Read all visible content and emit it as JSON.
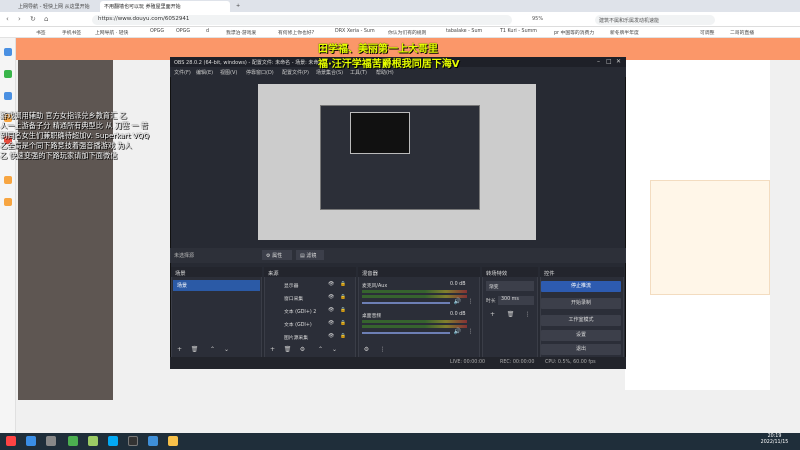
{
  "browser": {
    "tabs": [
      "上网导航 - 轻快上网 从这里开始",
      "不用翻墙也可以玩 养殖屋里面开始",
      "+"
    ],
    "url": "https://www.douyu.com/6052941",
    "search_hint": "建筑不属和乐属发动机速能",
    "zoom": "95%",
    "bookmarks": [
      "书签",
      "手机书签",
      "上网导航 · 轻快",
      "OPGG",
      "OPGG",
      "d",
      "我漂泊·游戏爱",
      "有何修上你也好?",
      "DRX Xeria - Sum",
      "你认为们有的规则",
      "tabalake - Sum",
      "T1 Kuri - Summ",
      "pr 中国等的消费力",
      "新冬牌半年度",
      "可调整",
      "二哥的直播"
    ]
  },
  "overlay": {
    "yellow_line1": "田学福、美丽第一上大哥里",
    "yellow_line2": "福·汪汗学福苦爵根我同居下海V",
    "white_lines": [
      "游戏调用辅助 官方女指派兑乡教育汇 乙",
      "人一上游备子分 精通所有典型比 从 刀塞 一 普",
      "到同名女生们兼职确待超加V: Superkart VQQ",
      "乙全局是个同下路竞技着强音播游戏 为人",
      "乙 快速变强的下路玩家请加下面微信"
    ]
  },
  "obs": {
    "title": "OBS 28.0.2 (64-bit, windows) - 配置文件: 未命名 - 场景: 未命名",
    "menu": [
      "文件(F)",
      "编辑(E)",
      "视图(V)",
      "停靠窗口(D)",
      "配置文件(P)",
      "场景集合(S)",
      "工具(T)",
      "帮助(H)"
    ],
    "toolbar": {
      "no_source": "未选择源",
      "properties": "属性",
      "filters": "滤镜"
    },
    "docks": {
      "scenes": {
        "title": "场景",
        "items": [
          "场景"
        ]
      },
      "sources": {
        "title": "来源",
        "items": [
          "显示器",
          "窗口采集",
          "文本 (GDI+) 2",
          "文本 (GDI+)",
          "图片源采集"
        ]
      },
      "mixer": {
        "title": "混音器",
        "tracks": [
          {
            "name": "麦克风/Aux",
            "db": "0.0 dB"
          },
          {
            "name": "桌面音频",
            "db": "0.0 dB"
          }
        ]
      },
      "transitions": {
        "title": "转场特效",
        "type": "渐变",
        "duration_label": "时长",
        "duration": "300 ms"
      },
      "controls": {
        "title": "控件",
        "buttons": [
          "停止推流",
          "开始录制",
          "工作室模式",
          "设置",
          "退出"
        ]
      }
    },
    "status": {
      "live": "LIVE: 00:00:00",
      "rec": "REC: 00:00:00",
      "cpu": "CPU: 0.5%, 60.00 fps"
    }
  },
  "taskbar": {
    "time": "20:19",
    "date": "2022/11/15"
  },
  "colors": {
    "accent": "#2d5bb0",
    "overlay_yellow": "#e6ff00",
    "brand": "#ff7a3c"
  }
}
